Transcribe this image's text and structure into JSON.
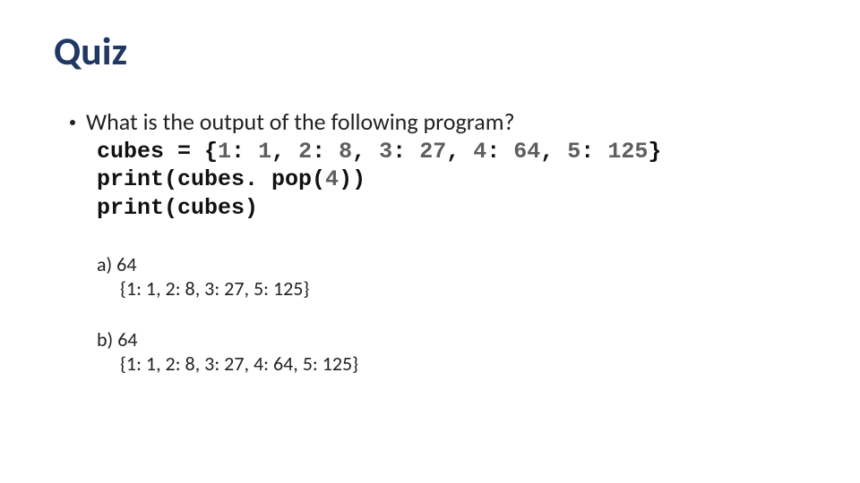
{
  "title": "Quiz",
  "question": "What is the output of the following program?",
  "code": {
    "l1a": "cubes = {",
    "l1n1": "1",
    "l1b": ": ",
    "l1n2": "1",
    "l1c": ", ",
    "l1n3": "2",
    "l1d": ": ",
    "l1n4": "8",
    "l1e": ", ",
    "l1n5": "3",
    "l1f": ": ",
    "l1n6": "27",
    "l1g": ", ",
    "l1n7": "4",
    "l1h": ": ",
    "l1n8": "64",
    "l1i": ", ",
    "l1n9": "5",
    "l1j": ": ",
    "l1n10": "125",
    "l1k": "}",
    "l2a": "print(cubes. pop(",
    "l2n1": "4",
    "l2b": "))",
    "l3": "print(cubes)"
  },
  "answers": {
    "a_label": "a) 64",
    "a_out": "{1: 1, 2: 8, 3: 27, 5: 125}",
    "b_label": "b) 64",
    "b_out": "{1: 1, 2: 8, 3: 27, 4: 64, 5: 125}"
  }
}
